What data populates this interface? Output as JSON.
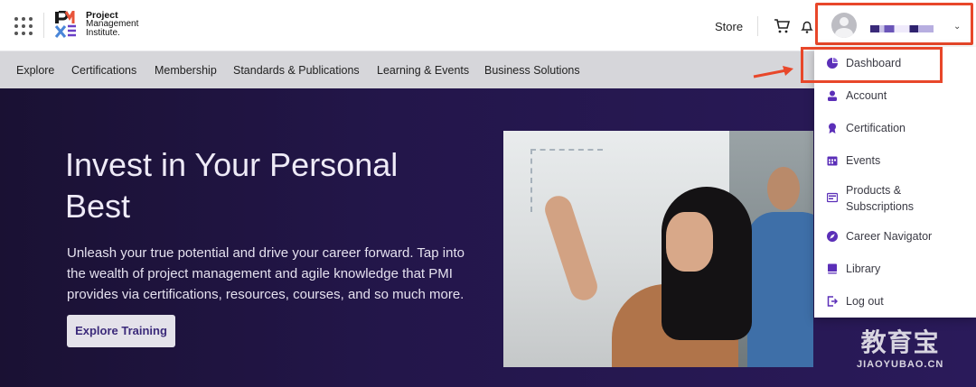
{
  "header": {
    "brand_line1": "Project",
    "brand_line2": "Management",
    "brand_line3": "Institute.",
    "store_label": "Store",
    "icons": [
      "apps-grid-icon",
      "cart-icon",
      "bell-icon",
      "chevron-down-icon"
    ]
  },
  "nav": {
    "items": [
      {
        "label": "Explore"
      },
      {
        "label": "Certifications"
      },
      {
        "label": "Membership"
      },
      {
        "label": "Standards & Publications"
      },
      {
        "label": "Learning & Events"
      },
      {
        "label": "Business Solutions"
      }
    ]
  },
  "hero": {
    "title": "Invest in Your Personal Best",
    "text": "Unleash your true potential and drive your career forward. Tap into the wealth of project management and agile knowledge that PMI provides via certifications, resources, courses, and so much more.",
    "cta_label": "Explore Training"
  },
  "user_menu": {
    "items": [
      {
        "label": "Dashboard",
        "icon": "pie-chart-icon"
      },
      {
        "label": "Account",
        "icon": "user-icon"
      },
      {
        "label": "Certification",
        "icon": "badge-icon"
      },
      {
        "label": "Events",
        "icon": "calendar-icon"
      },
      {
        "label": "Products & Subscriptions",
        "icon": "products-icon"
      },
      {
        "label": "Career Navigator",
        "icon": "compass-icon"
      },
      {
        "label": "Library",
        "icon": "book-icon"
      },
      {
        "label": "Log out",
        "icon": "logout-icon"
      }
    ]
  },
  "watermark": {
    "cn": "教育宝",
    "en": "JIAOYUBAO.CN"
  },
  "colors": {
    "accent": "#5b2fb8",
    "annotation_red": "#e8472a",
    "hero_bg": "#23164a",
    "nav_bg": "#d6d6da"
  }
}
